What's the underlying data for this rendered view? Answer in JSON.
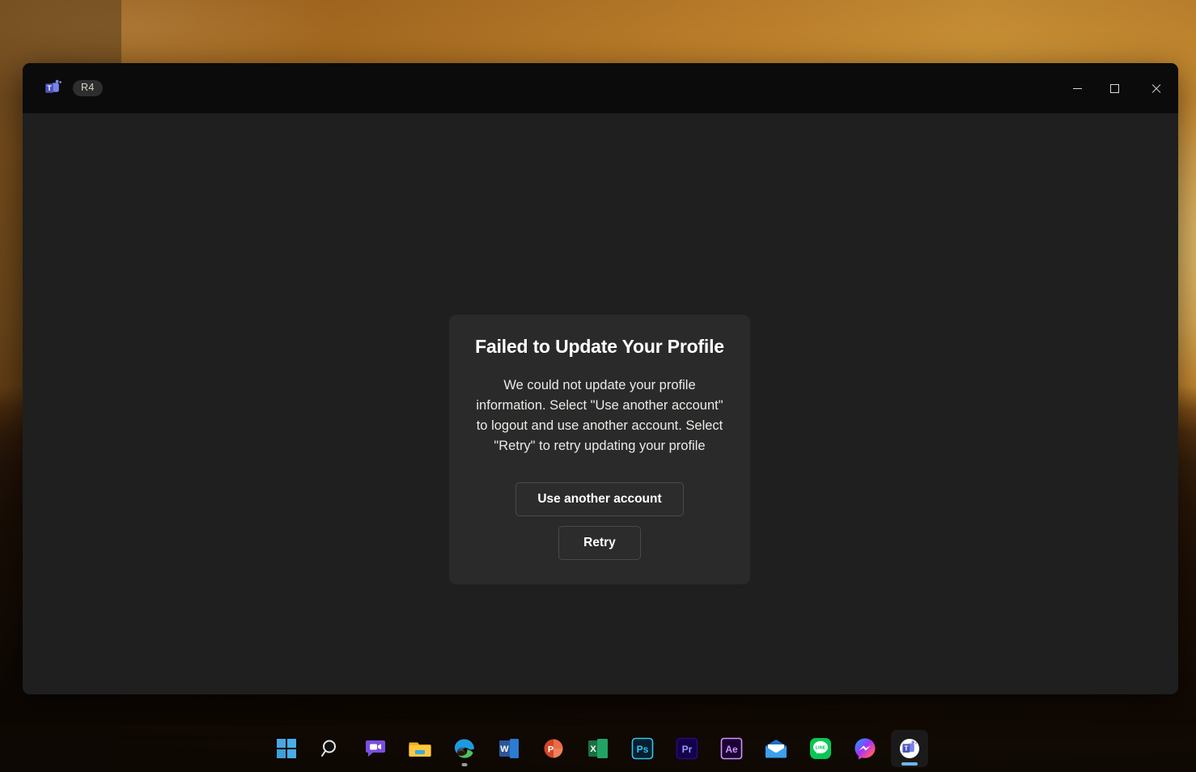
{
  "window": {
    "app_icon": "teams-icon",
    "badge_label": "R4",
    "caption": {
      "minimize_label": "Minimize",
      "maximize_label": "Maximize",
      "close_label": "Close"
    }
  },
  "dialog": {
    "title": "Failed to Update Your Profile",
    "message": "We could not update your profile information. Select \"Use another account\" to logout and use another account. Select \"Retry\" to retry updating your profile",
    "primary_button": "Use another account",
    "secondary_button": "Retry"
  },
  "taskbar": {
    "items": [
      {
        "name": "start-button",
        "label": "Start",
        "icon": "windows-icon",
        "state": "idle"
      },
      {
        "name": "search-button",
        "label": "Search",
        "icon": "search-icon",
        "state": "idle"
      },
      {
        "name": "chat-button",
        "label": "Chat",
        "icon": "chat-video-icon",
        "state": "idle"
      },
      {
        "name": "file-explorer-button",
        "label": "File Explorer",
        "icon": "folder-icon",
        "state": "idle"
      },
      {
        "name": "edge-button",
        "label": "Microsoft Edge",
        "icon": "edge-icon",
        "state": "running"
      },
      {
        "name": "word-button",
        "label": "Word",
        "icon": "word-icon",
        "state": "idle"
      },
      {
        "name": "powerpoint-button",
        "label": "PowerPoint",
        "icon": "powerpoint-icon",
        "state": "idle"
      },
      {
        "name": "excel-button",
        "label": "Excel",
        "icon": "excel-icon",
        "state": "idle"
      },
      {
        "name": "photoshop-button",
        "label": "Photoshop",
        "icon": "photoshop-icon",
        "state": "idle"
      },
      {
        "name": "premiere-button",
        "label": "Premiere Pro",
        "icon": "premiere-icon",
        "state": "idle"
      },
      {
        "name": "aftereffects-button",
        "label": "After Effects",
        "icon": "aftereffects-icon",
        "state": "idle"
      },
      {
        "name": "mail-button",
        "label": "Mail",
        "icon": "mail-icon",
        "state": "idle"
      },
      {
        "name": "line-button",
        "label": "LINE",
        "icon": "line-icon",
        "state": "idle"
      },
      {
        "name": "messenger-button",
        "label": "Messenger",
        "icon": "messenger-icon",
        "state": "idle"
      },
      {
        "name": "teams-taskbar-button",
        "label": "Microsoft Teams",
        "icon": "teams-icon",
        "state": "active"
      }
    ],
    "icon_text": {
      "word": "W",
      "powerpoint": "P",
      "excel": "X",
      "photoshop": "Ps",
      "premiere": "Pr",
      "aftereffects": "Ae",
      "line": "LINE",
      "teams": "T"
    }
  },
  "colors": {
    "window_bg": "#1f1f1f",
    "titlebar_bg": "#0b0b0b",
    "dialog_bg": "#2a2a2a",
    "button_border": "#4a4a4a",
    "text_primary": "#ffffff",
    "teams_purple": "#5059c9",
    "teams_blue": "#7b83eb",
    "accent_indicator": "#6fb6e8"
  }
}
